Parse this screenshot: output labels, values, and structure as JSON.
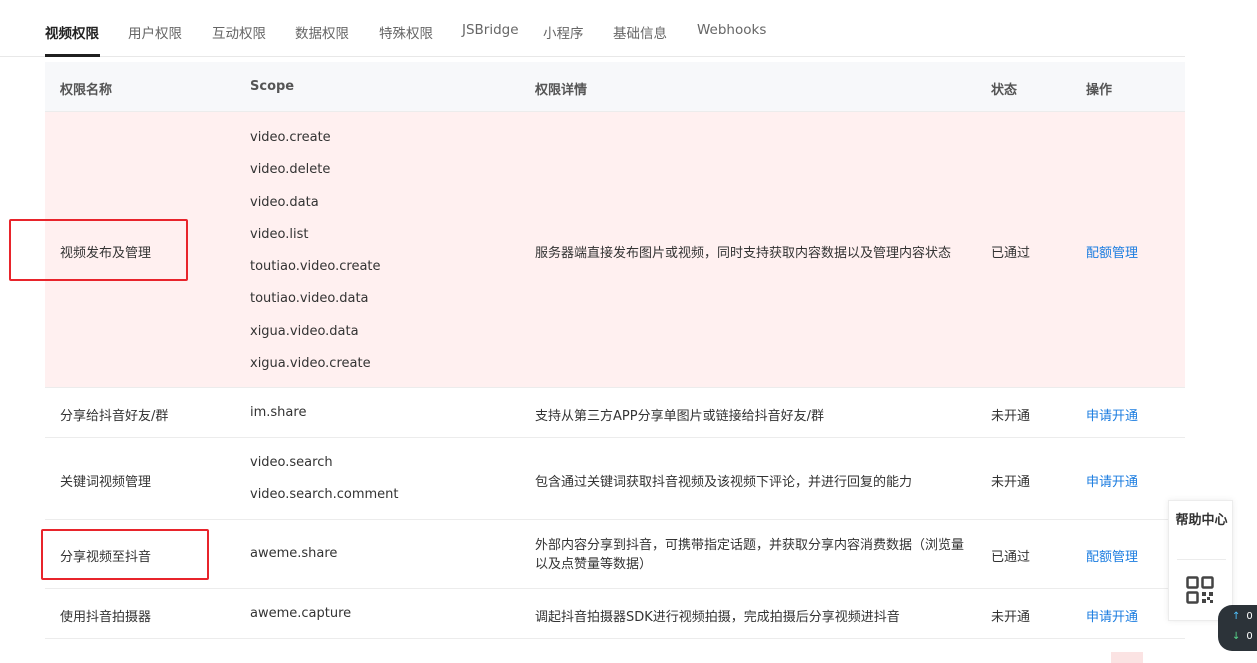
{
  "tabs": [
    {
      "label": "视频权限",
      "active": true
    },
    {
      "label": "用户权限",
      "active": false
    },
    {
      "label": "互动权限",
      "active": false
    },
    {
      "label": "数据权限",
      "active": false
    },
    {
      "label": "特殊权限",
      "active": false
    },
    {
      "label": "JSBridge",
      "active": false
    },
    {
      "label": "小程序",
      "active": false
    },
    {
      "label": "基础信息",
      "active": false
    },
    {
      "label": "Webhooks",
      "active": false
    }
  ],
  "table": {
    "headers": {
      "name": "权限名称",
      "scope": "Scope",
      "detail": "权限详情",
      "status": "状态",
      "action": "操作"
    },
    "rows": [
      {
        "name": "视频发布及管理",
        "scopes": [
          "video.create",
          "video.delete",
          "video.data",
          "video.list",
          "toutiao.video.create",
          "toutiao.video.data",
          "xigua.video.data",
          "xigua.video.create"
        ],
        "detail": "服务器端直接发布图片或视频，同时支持获取内容数据以及管理内容状态",
        "status": "已通过",
        "action": "配额管理"
      },
      {
        "name": "分享给抖音好友/群",
        "scopes": [
          "im.share"
        ],
        "detail": "支持从第三方APP分享单图片或链接给抖音好友/群",
        "status": "未开通",
        "action": "申请开通"
      },
      {
        "name": "关键词视频管理",
        "scopes": [
          "video.search",
          "video.search.comment"
        ],
        "detail": "包含通过关键词获取抖音视频及该视频下评论，并进行回复的能力",
        "status": "未开通",
        "action": "申请开通"
      },
      {
        "name": "分享视频至抖音",
        "scopes": [
          "aweme.share"
        ],
        "detail": "外部内容分享到抖音，可携带指定话题，并获取分享内容消费数据（浏览量以及点赞量等数据）",
        "status": "已通过",
        "action": "配额管理"
      },
      {
        "name": "使用抖音拍摄器",
        "scopes": [
          "aweme.capture"
        ],
        "detail": "调起抖音拍摄器SDK进行视频拍摄，完成拍摄后分享视频进抖音",
        "status": "未开通",
        "action": "申请开通"
      }
    ]
  },
  "help_panel": {
    "label": "帮助中心",
    "qr_icon": "qr-code-icon"
  },
  "net_badge": {
    "up": "0",
    "down": "0",
    "up_icon": "arrow-up-icon",
    "down_icon": "arrow-down-icon"
  },
  "colors": {
    "link": "#1c7de0",
    "highlight_row": "#fff0f0",
    "annotation_box": "#e8242b"
  }
}
